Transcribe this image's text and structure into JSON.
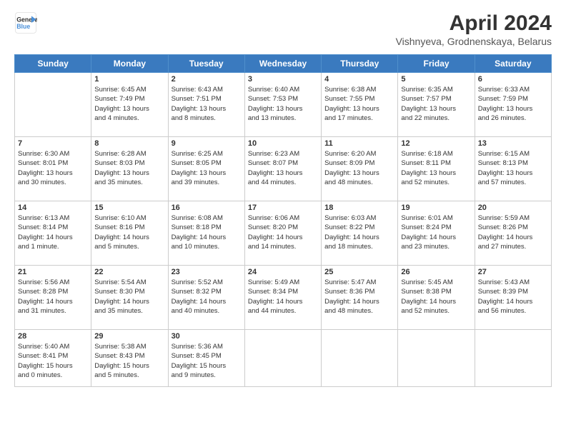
{
  "header": {
    "logo_line1": "General",
    "logo_line2": "Blue",
    "title": "April 2024",
    "subtitle": "Vishnyeva, Grodnenskaya, Belarus"
  },
  "days": [
    "Sunday",
    "Monday",
    "Tuesday",
    "Wednesday",
    "Thursday",
    "Friday",
    "Saturday"
  ],
  "weeks": [
    [
      {
        "date": "",
        "info": ""
      },
      {
        "date": "1",
        "info": "Sunrise: 6:45 AM\nSunset: 7:49 PM\nDaylight: 13 hours\nand 4 minutes."
      },
      {
        "date": "2",
        "info": "Sunrise: 6:43 AM\nSunset: 7:51 PM\nDaylight: 13 hours\nand 8 minutes."
      },
      {
        "date": "3",
        "info": "Sunrise: 6:40 AM\nSunset: 7:53 PM\nDaylight: 13 hours\nand 13 minutes."
      },
      {
        "date": "4",
        "info": "Sunrise: 6:38 AM\nSunset: 7:55 PM\nDaylight: 13 hours\nand 17 minutes."
      },
      {
        "date": "5",
        "info": "Sunrise: 6:35 AM\nSunset: 7:57 PM\nDaylight: 13 hours\nand 22 minutes."
      },
      {
        "date": "6",
        "info": "Sunrise: 6:33 AM\nSunset: 7:59 PM\nDaylight: 13 hours\nand 26 minutes."
      }
    ],
    [
      {
        "date": "7",
        "info": "Sunrise: 6:30 AM\nSunset: 8:01 PM\nDaylight: 13 hours\nand 30 minutes."
      },
      {
        "date": "8",
        "info": "Sunrise: 6:28 AM\nSunset: 8:03 PM\nDaylight: 13 hours\nand 35 minutes."
      },
      {
        "date": "9",
        "info": "Sunrise: 6:25 AM\nSunset: 8:05 PM\nDaylight: 13 hours\nand 39 minutes."
      },
      {
        "date": "10",
        "info": "Sunrise: 6:23 AM\nSunset: 8:07 PM\nDaylight: 13 hours\nand 44 minutes."
      },
      {
        "date": "11",
        "info": "Sunrise: 6:20 AM\nSunset: 8:09 PM\nDaylight: 13 hours\nand 48 minutes."
      },
      {
        "date": "12",
        "info": "Sunrise: 6:18 AM\nSunset: 8:11 PM\nDaylight: 13 hours\nand 52 minutes."
      },
      {
        "date": "13",
        "info": "Sunrise: 6:15 AM\nSunset: 8:13 PM\nDaylight: 13 hours\nand 57 minutes."
      }
    ],
    [
      {
        "date": "14",
        "info": "Sunrise: 6:13 AM\nSunset: 8:14 PM\nDaylight: 14 hours\nand 1 minute."
      },
      {
        "date": "15",
        "info": "Sunrise: 6:10 AM\nSunset: 8:16 PM\nDaylight: 14 hours\nand 5 minutes."
      },
      {
        "date": "16",
        "info": "Sunrise: 6:08 AM\nSunset: 8:18 PM\nDaylight: 14 hours\nand 10 minutes."
      },
      {
        "date": "17",
        "info": "Sunrise: 6:06 AM\nSunset: 8:20 PM\nDaylight: 14 hours\nand 14 minutes."
      },
      {
        "date": "18",
        "info": "Sunrise: 6:03 AM\nSunset: 8:22 PM\nDaylight: 14 hours\nand 18 minutes."
      },
      {
        "date": "19",
        "info": "Sunrise: 6:01 AM\nSunset: 8:24 PM\nDaylight: 14 hours\nand 23 minutes."
      },
      {
        "date": "20",
        "info": "Sunrise: 5:59 AM\nSunset: 8:26 PM\nDaylight: 14 hours\nand 27 minutes."
      }
    ],
    [
      {
        "date": "21",
        "info": "Sunrise: 5:56 AM\nSunset: 8:28 PM\nDaylight: 14 hours\nand 31 minutes."
      },
      {
        "date": "22",
        "info": "Sunrise: 5:54 AM\nSunset: 8:30 PM\nDaylight: 14 hours\nand 35 minutes."
      },
      {
        "date": "23",
        "info": "Sunrise: 5:52 AM\nSunset: 8:32 PM\nDaylight: 14 hours\nand 40 minutes."
      },
      {
        "date": "24",
        "info": "Sunrise: 5:49 AM\nSunset: 8:34 PM\nDaylight: 14 hours\nand 44 minutes."
      },
      {
        "date": "25",
        "info": "Sunrise: 5:47 AM\nSunset: 8:36 PM\nDaylight: 14 hours\nand 48 minutes."
      },
      {
        "date": "26",
        "info": "Sunrise: 5:45 AM\nSunset: 8:38 PM\nDaylight: 14 hours\nand 52 minutes."
      },
      {
        "date": "27",
        "info": "Sunrise: 5:43 AM\nSunset: 8:39 PM\nDaylight: 14 hours\nand 56 minutes."
      }
    ],
    [
      {
        "date": "28",
        "info": "Sunrise: 5:40 AM\nSunset: 8:41 PM\nDaylight: 15 hours\nand 0 minutes."
      },
      {
        "date": "29",
        "info": "Sunrise: 5:38 AM\nSunset: 8:43 PM\nDaylight: 15 hours\nand 5 minutes."
      },
      {
        "date": "30",
        "info": "Sunrise: 5:36 AM\nSunset: 8:45 PM\nDaylight: 15 hours\nand 9 minutes."
      },
      {
        "date": "",
        "info": ""
      },
      {
        "date": "",
        "info": ""
      },
      {
        "date": "",
        "info": ""
      },
      {
        "date": "",
        "info": ""
      }
    ]
  ]
}
